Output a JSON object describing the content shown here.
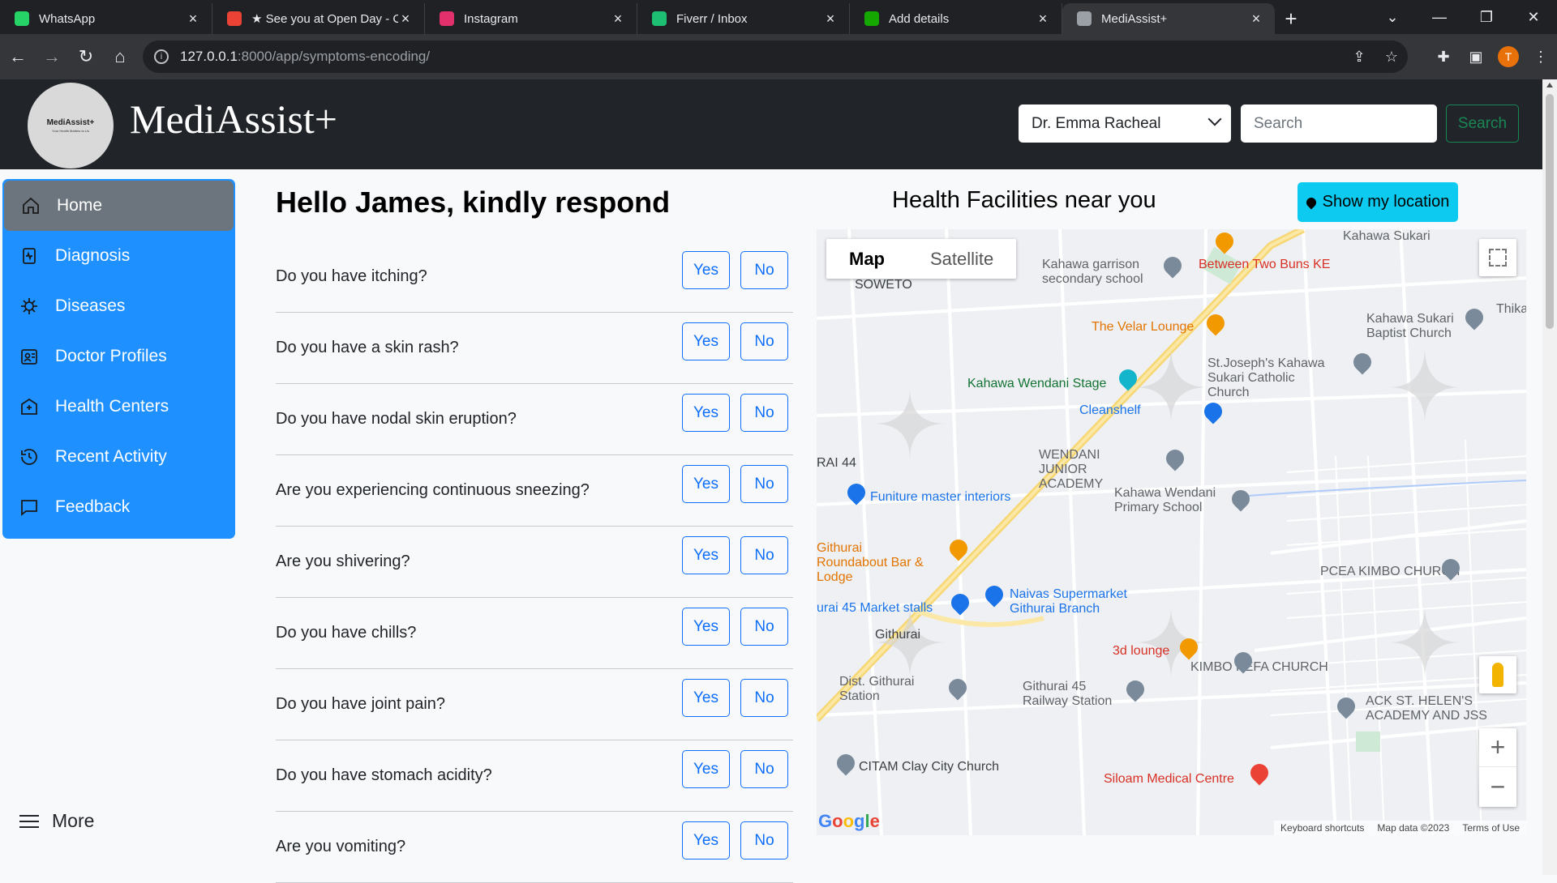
{
  "browser": {
    "tabs": [
      {
        "title": "WhatsApp",
        "icon": "whatsapp-icon",
        "color": "#25D366"
      },
      {
        "title": "★ See you at Open Day - C",
        "icon": "gmail-icon",
        "color": "#EA4335"
      },
      {
        "title": "Instagram",
        "icon": "instagram-icon",
        "color": "#E1306C"
      },
      {
        "title": "Fiverr / Inbox",
        "icon": "fiverr-icon",
        "color": "#1DBF73"
      },
      {
        "title": "Add details",
        "icon": "upwork-icon",
        "color": "#14A800"
      },
      {
        "title": "MediAssist+",
        "icon": "globe-icon",
        "color": "#9AA0A6"
      }
    ],
    "url_host": "127.0.0.1",
    "url_path": ":8000/app/symptoms-encoding/",
    "profile_initial": "T"
  },
  "header": {
    "brand": "MediAssist+",
    "logo_text": "MediAssist+",
    "logo_tagline": "Your Health Matters to Us",
    "doctor_selected": "Dr. Emma Racheal",
    "search_placeholder": "Search",
    "search_button": "Search"
  },
  "sidebar": {
    "items": [
      {
        "label": "Home",
        "icon": "home-icon"
      },
      {
        "label": "Diagnosis",
        "icon": "clipboard-pulse-icon"
      },
      {
        "label": "Diseases",
        "icon": "virus-icon"
      },
      {
        "label": "Doctor Profiles",
        "icon": "doctor-id-icon"
      },
      {
        "label": "Health Centers",
        "icon": "hospital-icon"
      },
      {
        "label": "Recent Activity",
        "icon": "history-icon"
      },
      {
        "label": "Feedback",
        "icon": "chat-icon"
      }
    ],
    "more_label": "More"
  },
  "questions": {
    "greeting": "Hello James, kindly respond",
    "yes_label": "Yes",
    "no_label": "No",
    "items": [
      "Do you have itching?",
      "Do you have a skin rash?",
      "Do you have nodal skin eruption?",
      "Are you experiencing continuous sneezing?",
      "Are you shivering?",
      "Do you have chills?",
      "Do you have joint pain?",
      "Do you have stomach acidity?",
      "Are you vomiting?"
    ]
  },
  "map": {
    "title": "Health Facilities near you",
    "show_location_button": "Show my location",
    "toggle_map": "Map",
    "toggle_satellite": "Satellite",
    "labels": [
      "Kahawa garrison secondary school",
      "Between Two Buns KE",
      "SOWETO",
      "The Velar Lounge",
      "Kahawa Sukari Baptist Church",
      "St.Joseph's Kahawa Sukari Catholic Church",
      "Kahawa Wendani Stage",
      "Cleanshelf",
      "WENDANI JUNIOR ACADEMY",
      "Funiture master interiors",
      "Kahawa Wendani Primary School",
      "Githurai Roundabout Bar & Lodge",
      "Naivas Supermarket Githurai Branch",
      "urai 45 Market stalls",
      "PCEA KIMBO CHURCH",
      "Githurai",
      "3d lounge",
      "KIMBO PEFA CHURCH",
      "Githurai 45 Railway Station",
      "ACK ST. HELEN'S ACADEMY AND JSS",
      "CITAM Clay City Church",
      "Siloam Medical Centre",
      "RAI 44",
      "Kahawa Sukari",
      "Thika",
      "Dist. Githurai Station"
    ],
    "footer": [
      "Keyboard shortcuts",
      "Map data ©2023",
      "Terms of Use"
    ],
    "brand_letters": [
      "G",
      "o",
      "o",
      "g",
      "l",
      "e"
    ]
  }
}
